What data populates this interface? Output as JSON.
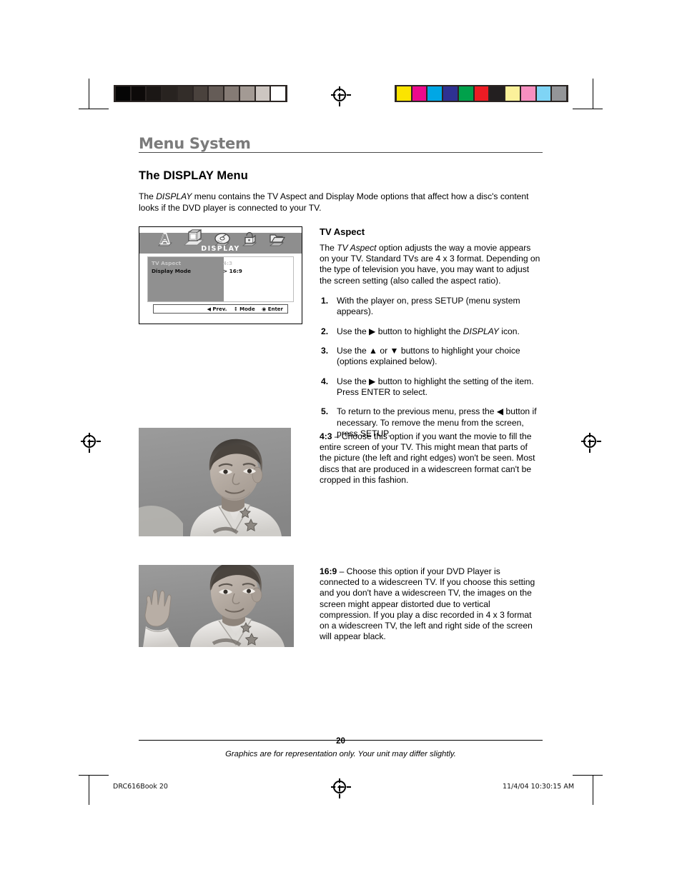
{
  "printer_marks": {
    "grayscale_bar": [
      "#050505",
      "#0d0a09",
      "#1b1715",
      "#282320",
      "#332d29",
      "#4a423d",
      "#655c57",
      "#857b75",
      "#a39a94",
      "#cdc6c1",
      "#ffffff"
    ],
    "color_bar": [
      "#fbe400",
      "#ec0a8c",
      "#00a7e5",
      "#2e3192",
      "#00a14b",
      "#ed1c24",
      "#231f20",
      "#fbf19a",
      "#f78fc0",
      "#7fd4f5",
      "#939598"
    ],
    "registration_icon": "registration-target-icon"
  },
  "header": {
    "chapter_title": "Menu System",
    "section_title": "The DISPLAY Menu",
    "intro_prefix": "The ",
    "intro_italic": "DISPLAY",
    "intro_rest": " menu contains the TV Aspect and Display Mode options that affect how a disc's content looks if the DVD player is connected to your TV."
  },
  "osd": {
    "title": "DISPLAY",
    "icons": [
      {
        "name": "language-a-icon",
        "label": "A"
      },
      {
        "name": "display-tv-icon",
        "label": "TV"
      },
      {
        "name": "audio-disc-icon",
        "label": "Disc"
      },
      {
        "name": "parental-lock-icon",
        "label": "Lock"
      },
      {
        "name": "other-folder-icon",
        "label": "Folder"
      }
    ],
    "rows": [
      {
        "label": "TV Aspect",
        "value": "4:3",
        "state": "dim"
      },
      {
        "label": "Display Mode",
        "value": "> 16:9",
        "state": "on"
      }
    ],
    "footer_hints": [
      {
        "glyph": "◀",
        "text": "Prev."
      },
      {
        "glyph": "↕",
        "text": "Mode"
      },
      {
        "glyph": "◉",
        "text": "Enter"
      }
    ]
  },
  "tv_aspect": {
    "heading": "TV Aspect",
    "para_1_a": "The ",
    "para_1_italic": "TV Aspect",
    "para_1_b": " option adjusts the way a movie appears on your TV. Standard TVs are 4 x 3 format. Depending on the type of television you have, you may want to adjust the screen setting (also called the aspect ratio).",
    "steps": [
      {
        "num": "1.",
        "text_a": "With the player on, press SETUP (menu system appears).",
        "text_b": "",
        "italic": "",
        "glyph": ""
      },
      {
        "num": "2.",
        "text_a": "Use the ",
        "glyph": "▶",
        "text_b": " button to highlight the ",
        "italic": "DISPLAY",
        "text_c": " icon."
      },
      {
        "num": "3.",
        "text_a": "Use the ",
        "glyph": "▲",
        "text_b": " or ",
        "glyph2": "▼",
        "text_c": " buttons to highlight your choice (options explained below)."
      },
      {
        "num": "4.",
        "text_a": "Use the ",
        "glyph": "▶",
        "text_b": " button to highlight the setting of the item. Press ENTER to select."
      },
      {
        "num": "5.",
        "text_a": "To return to the previous menu, press the ",
        "glyph": "◀",
        "text_b": " button if necessary. To remove the menu from the screen, press SETUP."
      }
    ]
  },
  "options": [
    {
      "label": "4:3",
      "body": " – Choose this option if you want the movie to fill the entire screen of your TV. This might mean that parts of the picture (the left and right edges) won't be seen. Most discs that are produced in a widescreen format can't be cropped in this fashion.",
      "photo_name": "photo-boy-4x3",
      "photo_alt": "Grayscale photo of a boy in a white martial arts uniform"
    },
    {
      "label": "16:9",
      "body": "  – Choose this option if your DVD Player is connected to a widescreen TV. If you choose this setting and you don't have a widescreen TV, the images on the screen might appear distorted due to vertical compression. If you play a disc recorded in 4 x 3 format on a widescreen TV, the left and right side of the screen will appear black.",
      "photo_name": "photo-boy-16x9",
      "photo_alt": "Grayscale widescreen photo of a boy in a white martial arts uniform with raised hand"
    }
  ],
  "footer": {
    "page_number": "20",
    "note": "Graphics are for representation only. Your unit may differ slightly.",
    "slug_left": "DRC616Book   20",
    "slug_right": "11/4/04   10:30:15 AM"
  }
}
